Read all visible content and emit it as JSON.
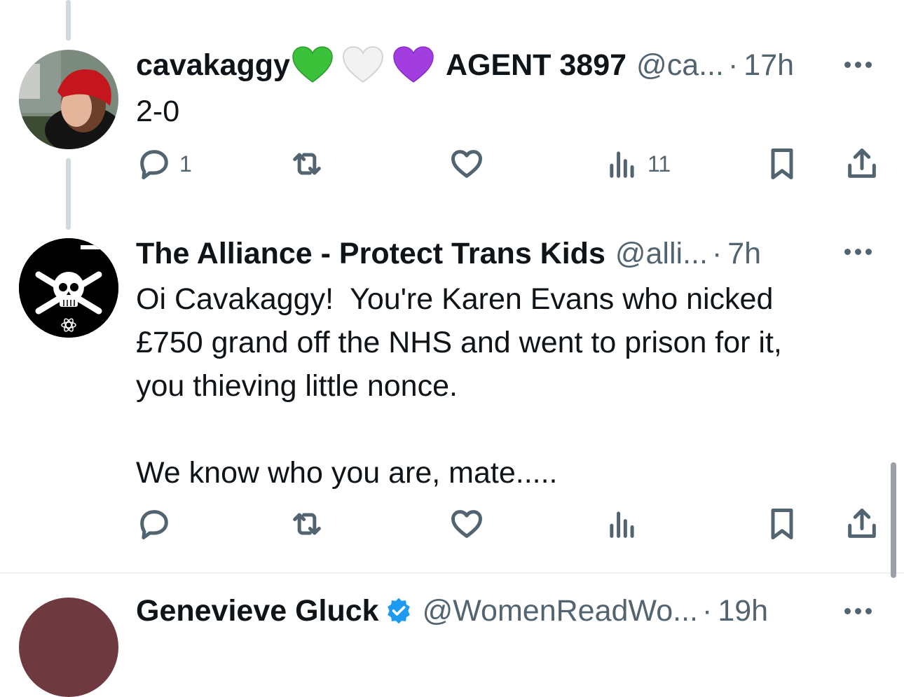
{
  "tweets": [
    {
      "name": "cavakaggy",
      "display_suffix": "AGENT 3897",
      "emojis": [
        "green-heart",
        "white-heart",
        "purple-heart"
      ],
      "handle": "@ca...",
      "dot": "·",
      "time": "17h",
      "text": "2-0",
      "replies": "1",
      "retweets": "",
      "likes": "",
      "views": "11"
    },
    {
      "name": "The Alliance - Protect Trans Kids",
      "handle": "@alli...",
      "dot": "·",
      "time": "7h",
      "text": "Oi Cavakaggy!  You're Karen Evans who nicked\n£750 grand off the NHS and went to prison for it,\nyou thieving little nonce.\n\nWe know who you are, mate.....",
      "replies": "",
      "retweets": "",
      "likes": "",
      "views": ""
    },
    {
      "name": "Genevieve Gluck",
      "handle": "@WomenReadWo...",
      "dot": "·",
      "time": "19h"
    }
  ],
  "colors": {
    "text": "#0f1419",
    "muted": "#536471",
    "verified": "#1d9bf0",
    "thread_line": "#cfd9de"
  }
}
